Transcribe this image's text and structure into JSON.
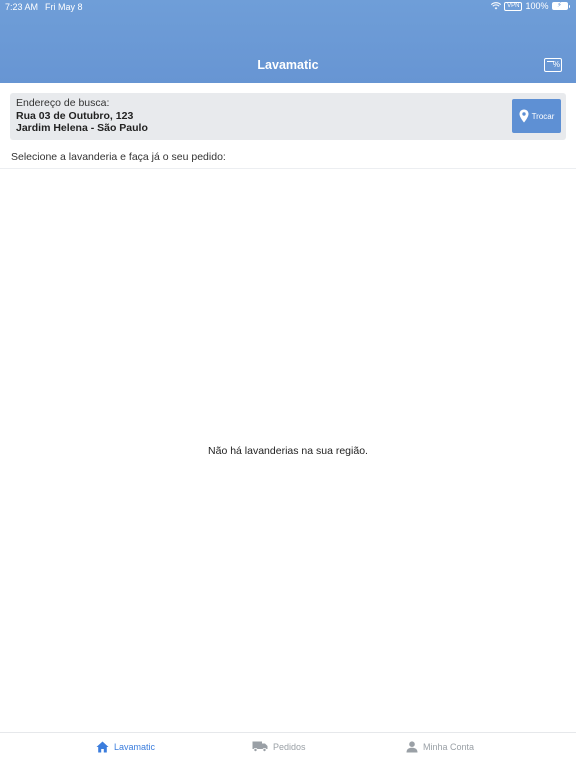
{
  "status_bar": {
    "time": "7:23 AM",
    "date": "Fri May 8",
    "vpn": "VPN",
    "battery": "100%",
    "icons": [
      "wifi-icon",
      "battery-icon",
      "bolt-icon"
    ]
  },
  "nav": {
    "title": "Lavamatic",
    "right_icon": "discount-icon",
    "discount_symbol": "%"
  },
  "address": {
    "label": "Endereço de busca:",
    "line1": "Rua 03 de Outubro, 123",
    "line2": "Jardim Helena - São Paulo",
    "change_button": "Trocar",
    "change_icon": "map-pin-icon"
  },
  "instruction": "Selecione a lavanderia e faça já o seu pedido:",
  "empty_message": "Não há lavanderias na sua região.",
  "tabs": [
    {
      "label": "Lavamatic",
      "icon": "home-icon",
      "active": true
    },
    {
      "label": "Pedidos",
      "icon": "truck-icon",
      "active": false
    },
    {
      "label": "Minha Conta",
      "icon": "user-icon",
      "active": false
    }
  ],
  "colors": {
    "header": "#6795d3",
    "accent": "#3b7ddd",
    "button": "#5e90d4",
    "inactive_tab": "#9aa0a6"
  }
}
